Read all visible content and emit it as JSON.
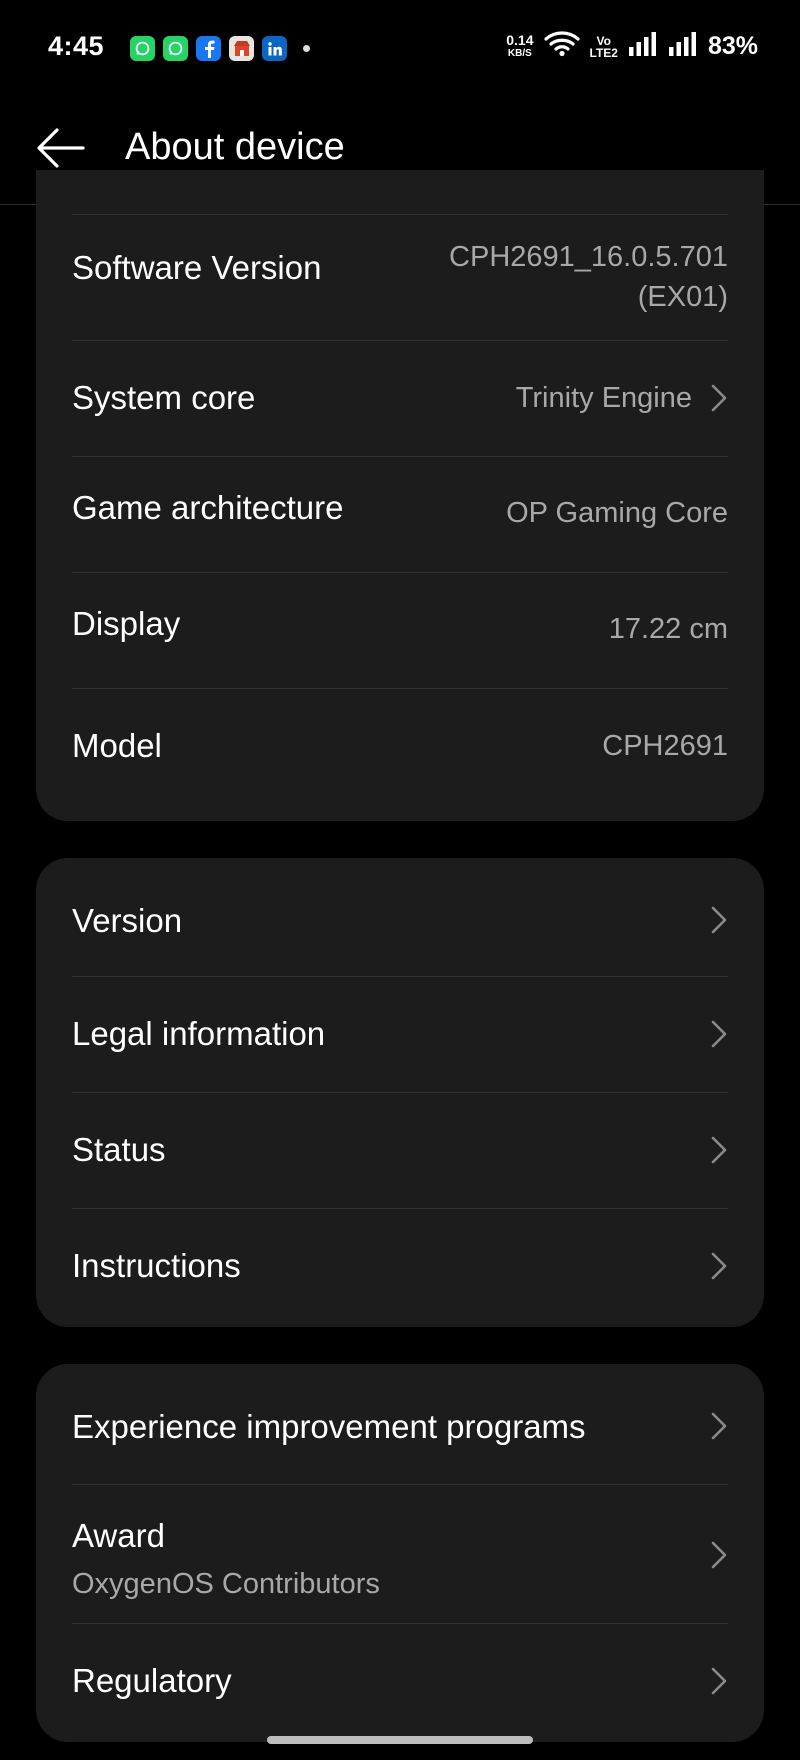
{
  "status_bar": {
    "time": "4:45",
    "net_speed": "0.14",
    "net_unit": "KB/S",
    "volte_top": "Vo",
    "volte_bottom": "LTE2",
    "battery": "83%",
    "notification_icons": [
      "whatsapp-icon",
      "whatsapp-business-icon",
      "facebook-icon",
      "shop-icon",
      "linkedin-icon"
    ]
  },
  "header": {
    "title": "About device"
  },
  "specs": [
    {
      "label": "Software Version",
      "value_line1": "CPH2691_16.0.5.701",
      "value_line2": "(EX01)"
    },
    {
      "label": "System core",
      "value": "Trinity Engine"
    },
    {
      "label": "Game architecture",
      "value": "OP Gaming Core"
    },
    {
      "label": "Display",
      "value": "17.22 cm"
    },
    {
      "label": "Model",
      "value": "CPH2691"
    }
  ],
  "menu": [
    {
      "label": "Version"
    },
    {
      "label": "Legal information"
    },
    {
      "label": "Status"
    },
    {
      "label": "Instructions"
    }
  ],
  "more": [
    {
      "label": "Experience improvement programs"
    },
    {
      "label": "Award",
      "sub": "OxygenOS Contributors"
    },
    {
      "label": "Regulatory"
    }
  ],
  "colors": {
    "background": "#000000",
    "card": "#1c1c1c",
    "secondary_text": "#a8a8a8",
    "whatsapp": "#25d366",
    "facebook": "#1877f2",
    "linkedin": "#0a66c2"
  }
}
